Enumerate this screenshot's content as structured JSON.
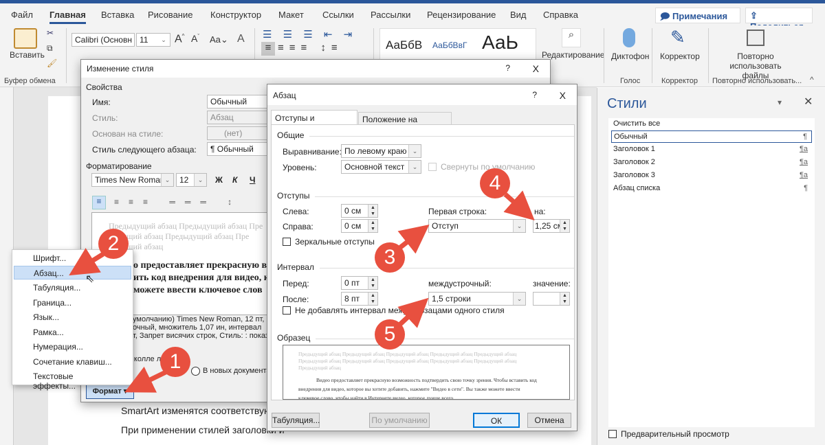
{
  "colors": {
    "accent": "#2b579a",
    "callout": "#e8503f",
    "selected": "#cce0f7"
  },
  "tabs": [
    "Файл",
    "Главная",
    "Вставка",
    "Рисование",
    "Конструктор",
    "Макет",
    "Ссылки",
    "Рассылки",
    "Рецензирование",
    "Вид",
    "Справка"
  ],
  "active_tab": "Главная",
  "top_buttons": {
    "comments": "Примечания",
    "share": "Поделиться"
  },
  "ribbon": {
    "paste": "Вставить",
    "clipboard_group": "Буфер обмена",
    "font": "Calibri (Основн",
    "font_size": "11",
    "case": "Aa",
    "style_samples": [
      "АаБбВ",
      "АаБбВвГ",
      "АаЬ"
    ],
    "editing": "Редактирование",
    "dictate": "Диктофон",
    "voice_group": "Голос",
    "editor": "Корректор",
    "editor_group": "Корректор",
    "reuse": "Повторно использовать файлы",
    "reuse_group": "Повторно использовать..."
  },
  "document": {
    "line1": "SmartArt изменятся соответствующи",
    "line2": "При применении стилей заголовки и"
  },
  "styles_pane": {
    "title": "Стили",
    "items": [
      {
        "label": "Очистить все",
        "mark": ""
      },
      {
        "label": "Обычный",
        "mark": "¶",
        "selected": true
      },
      {
        "label": "Заголовок 1",
        "mark": "¶a"
      },
      {
        "label": "Заголовок 2",
        "mark": "¶a"
      },
      {
        "label": "Заголовок 3",
        "mark": "¶a"
      },
      {
        "label": "Абзац списка",
        "mark": "¶"
      }
    ],
    "preview": "Предварительный просмотр"
  },
  "modify_style": {
    "title": "Изменение стиля",
    "help": "?",
    "close": "X",
    "properties": "Свойства",
    "name_label": "Имя:",
    "name_value": "Обычный",
    "style_label": "Стиль:",
    "style_value": "Абзац",
    "based_label": "Основан на стиле:",
    "based_value": "(нет)",
    "next_label": "Стиль следующего абзаца:",
    "next_value": "¶ Обычный",
    "formatting": "Форматирование",
    "font": "Times New Roman",
    "size": "12",
    "bold": "Ж",
    "italic": "К",
    "underline": "Ч",
    "preview_prev": "Предыдущий абзац Предыдущий абзац Пре",
    "preview_prev2": "дыдущий абзац Предыдущий абзац Пре",
    "preview_prev3": "дыдущий абзац",
    "preview_main1": "о предоставляет прекрасную во",
    "preview_main2": "ить код внедрения для видео, к",
    "preview_main3": "можете ввести ключевое слов",
    "desc1": "умолчанию) Times New Roman, 12 пт,",
    "desc2": "очный,  множитель 1,07 ин, интервал",
    "desc3": "т, Запрет висячих строк, Стиль: : показ",
    "add_gallery": "в колле          лей",
    "new_docs": "В новых документа",
    "format_button": "Формат"
  },
  "format_menu": [
    "Шрифт...",
    "Абзац...",
    "Табуляция...",
    "Граница...",
    "Язык...",
    "Рамка...",
    "Нумерация...",
    "Сочетание клавиш...",
    "Текстовые эффекты..."
  ],
  "format_menu_selected": "Абзац...",
  "paragraph": {
    "title": "Абзац",
    "help": "?",
    "close": "X",
    "tabs": [
      "Отступы и интервалы",
      "Положение на странице"
    ],
    "general": "Общие",
    "alignment_label": "Выравнивание:",
    "alignment": "По левому краю",
    "level_label": "Уровень:",
    "level": "Основной текст",
    "collapsed": "Свернуты по умолчанию",
    "indents": "Отступы",
    "left_label": "Слева:",
    "left": "0 см",
    "right_label": "Справа:",
    "right": "0 см",
    "first_line_label": "Первая строка:",
    "first_line": "Отступ",
    "by_label": "на:",
    "by": "1,25 см",
    "mirror": "Зеркальные отступы",
    "spacing": "Интервал",
    "before_label": "Перед:",
    "before": "0 пт",
    "after_label": "После:",
    "after": "8 пт",
    "line_label": "междустрочный:",
    "line": "1,5 строки",
    "value_label": "значение:",
    "value": "",
    "no_space": "Не добавлять интервал между абзацами одного стиля",
    "sample": "Образец",
    "sample_prev": "Предыдущий абзац Предыдущий абзац Предыдущий абзац Предыдущий абзац Предыдущий абзац",
    "sample_prev2": "Предыдущий абзац Предыдущий абзац Предыдущий абзац Предыдущий абзац Предыдущий абзац",
    "sample_prev3": "Предыдущий абзац",
    "sample_text1": "Видео предоставляет прекрасную возможность подтвердить свою точку зрения. Чтобы вставить код",
    "sample_text2": "внедрения для видео, которое вы хотите добавить, нажмите \"Видео в сети\". Вы также можете ввести",
    "sample_text3": "ключевое слово, чтобы найти в Интернете видео, которое лучше всего",
    "tabs_button": "Табуляция...",
    "default_button": "По умолчанию",
    "ok": "ОК",
    "cancel": "Отмена"
  },
  "callouts": [
    "1",
    "2",
    "3",
    "4",
    "5"
  ]
}
